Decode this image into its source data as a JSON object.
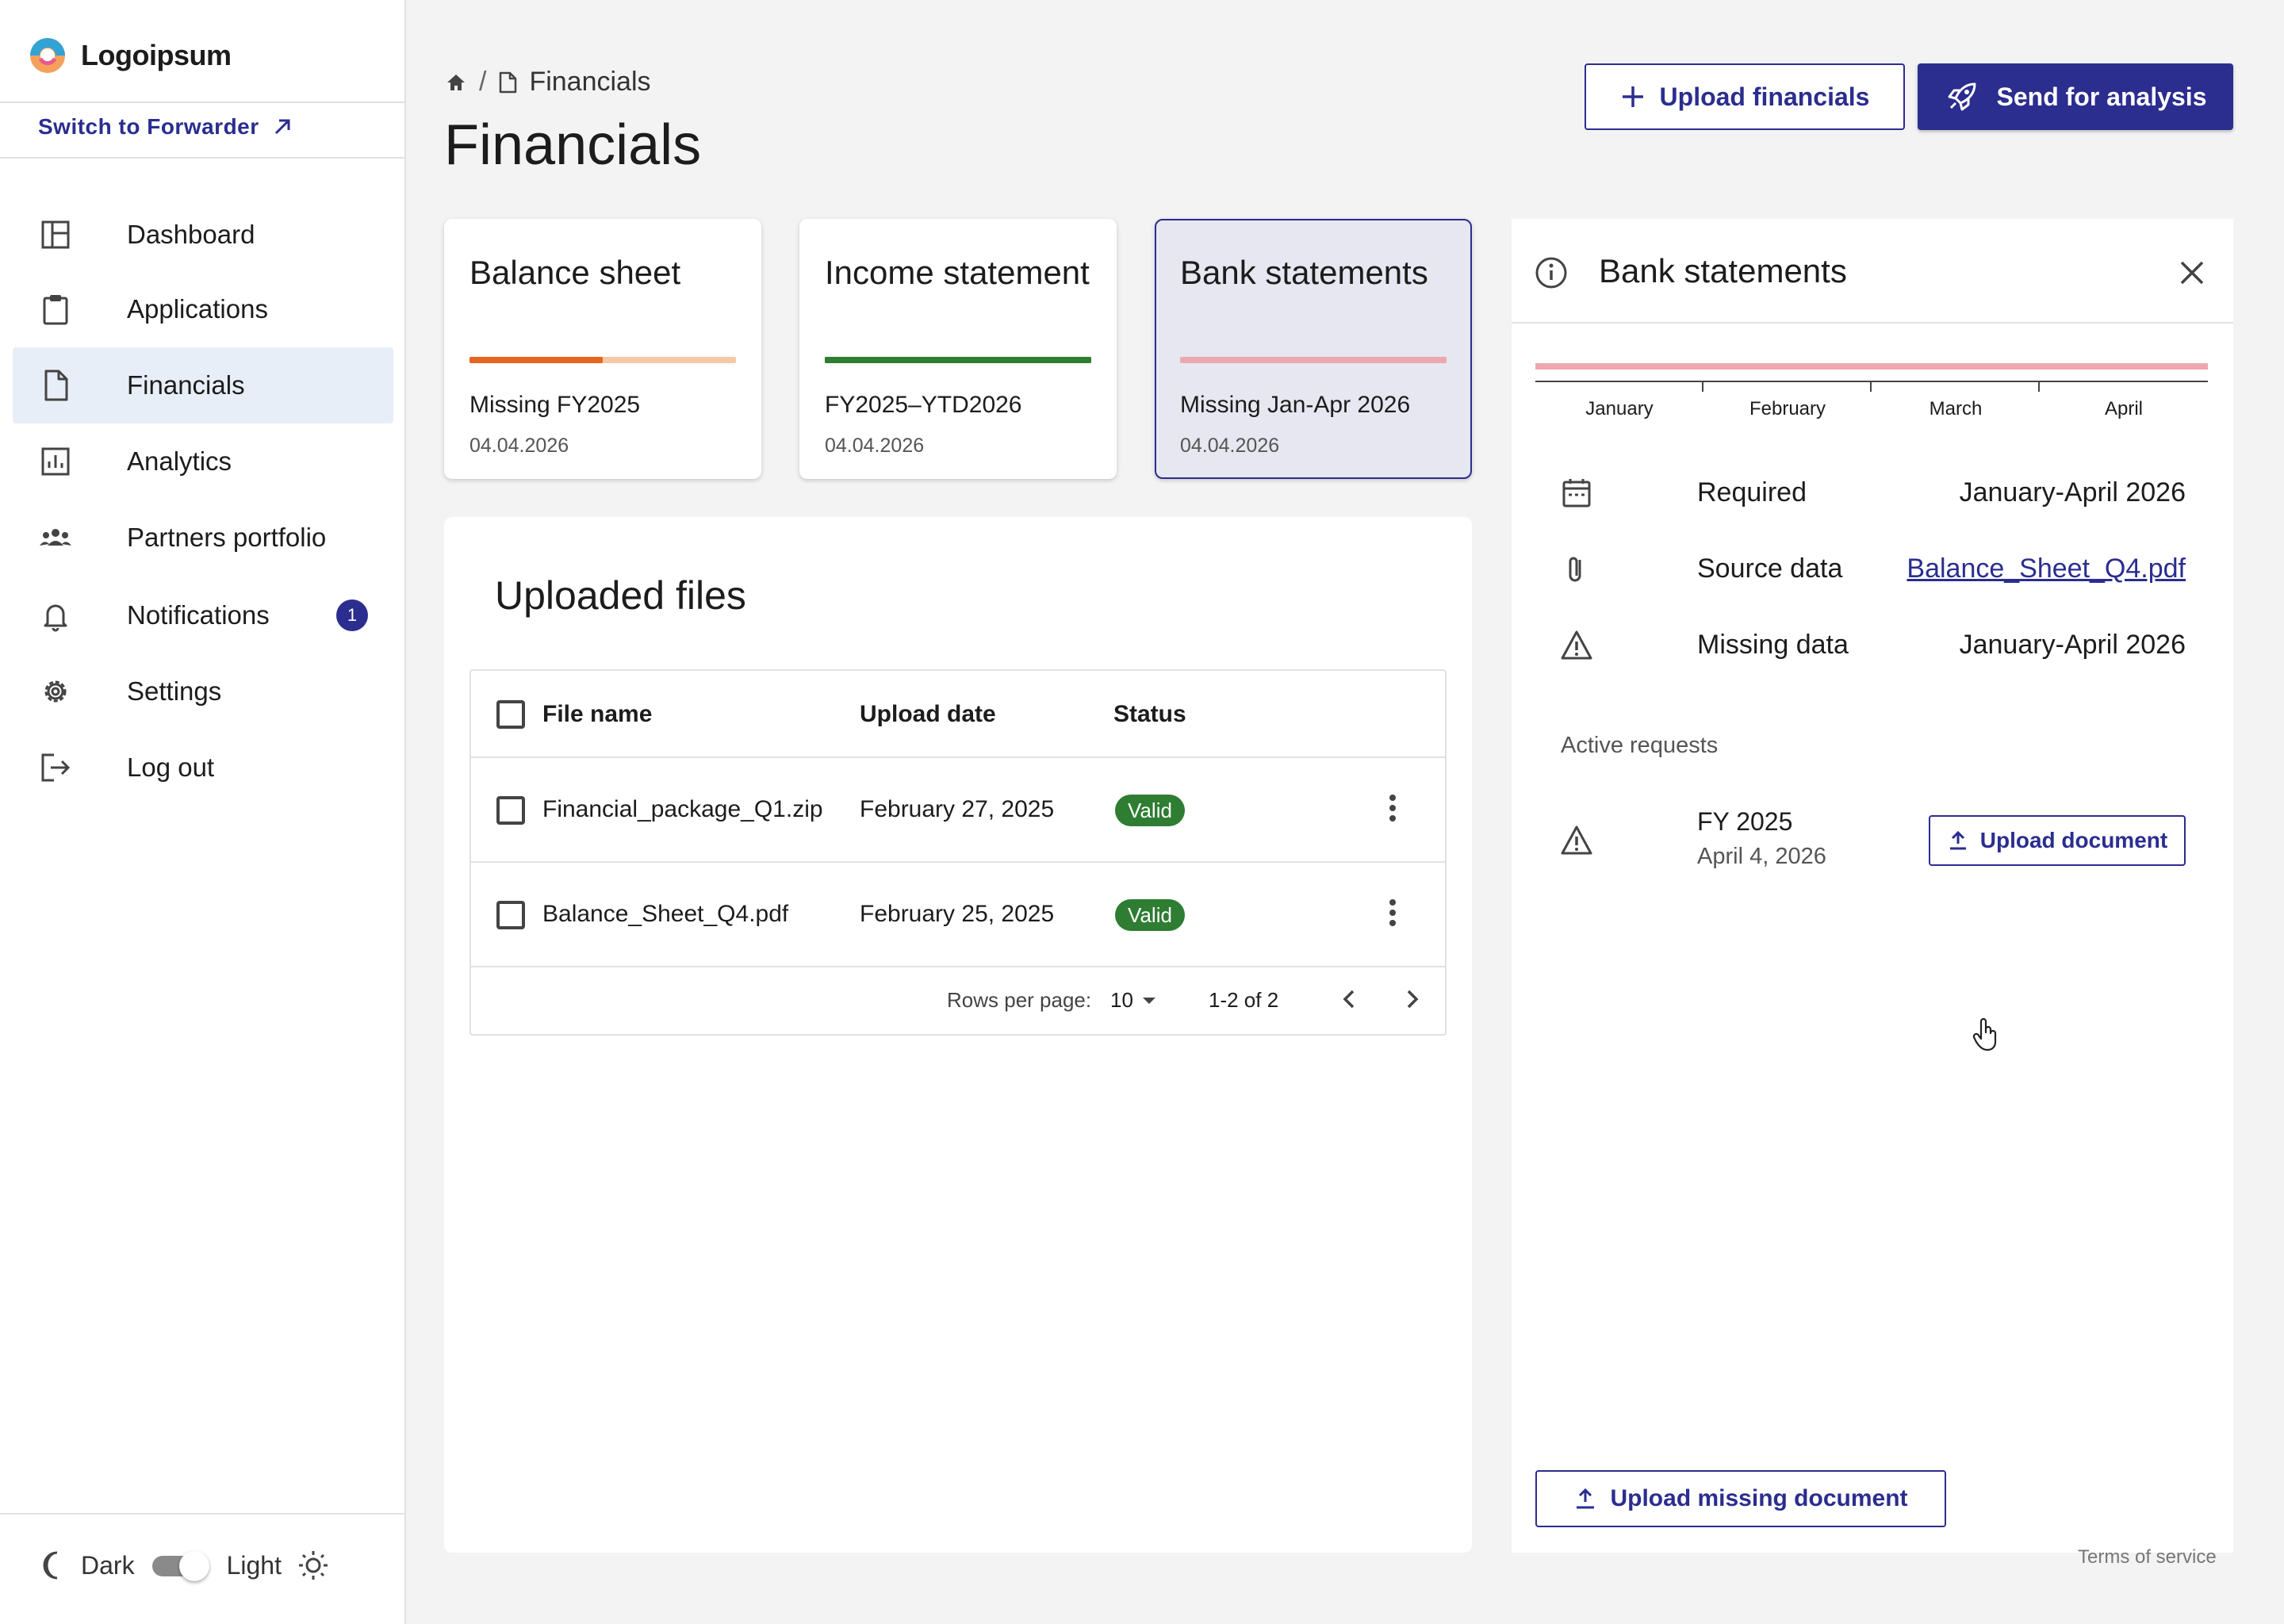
{
  "brand": {
    "name": "Logoipsum"
  },
  "sidebar": {
    "switch_link": "Switch to Forwarder",
    "items": [
      {
        "label": "Dashboard",
        "icon": "dashboard-icon"
      },
      {
        "label": "Applications",
        "icon": "clipboard-icon"
      },
      {
        "label": "Financials",
        "icon": "document-icon",
        "active": true
      },
      {
        "label": "Analytics",
        "icon": "bar-chart-icon"
      },
      {
        "label": "Partners portfolio",
        "icon": "people-icon"
      },
      {
        "label": "Notifications",
        "icon": "bell-icon",
        "badge": "1"
      },
      {
        "label": "Settings",
        "icon": "gear-icon"
      },
      {
        "label": "Log out",
        "icon": "logout-icon"
      }
    ],
    "theme": {
      "dark_label": "Dark",
      "light_label": "Light",
      "selected": "Light"
    }
  },
  "header": {
    "breadcrumb": {
      "current": "Financials"
    },
    "title": "Financials",
    "upload_button": "Upload financials",
    "send_button": "Send for analysis"
  },
  "cards": [
    {
      "title": "Balance sheet",
      "desc": "Missing FY2025",
      "date": "04.04.2026",
      "progress": 0.5,
      "bar_color": "#e8651c",
      "bar_track": "#f5c8a6"
    },
    {
      "title": "Income statement",
      "desc": "FY2025–YTD2026",
      "date": "04.04.2026",
      "progress": 1.0,
      "bar_color": "#2e7d32",
      "bar_track": "#2e7d32"
    },
    {
      "title": "Bank statements",
      "desc": "Missing Jan-Apr 2026",
      "date": "04.04.2026",
      "progress": 0.0,
      "bar_color": "#eca8ae",
      "bar_track": "#eca8ae",
      "selected": true
    }
  ],
  "files": {
    "title": "Uploaded files",
    "columns": {
      "name": "File name",
      "date": "Upload date",
      "status": "Status"
    },
    "rows": [
      {
        "name": "Financial_package_Q1.zip",
        "date": "February 27, 2025",
        "status": "Valid"
      },
      {
        "name": "Balance_Sheet_Q4.pdf",
        "date": "February 25, 2025",
        "status": "Valid"
      }
    ],
    "pagination": {
      "rows_label": "Rows per page:",
      "rows_value": "10",
      "range": "1-2 of 2"
    }
  },
  "detail": {
    "title": "Bank statements",
    "months": [
      "January",
      "February",
      "March",
      "April"
    ],
    "timeline_color": "#eca8ae",
    "info": [
      {
        "label": "Required",
        "value": "January-April 2026",
        "icon": "calendar-icon"
      },
      {
        "label": "Source data",
        "value": "Balance_Sheet_Q4.pdf",
        "icon": "paperclip-icon",
        "link": true
      },
      {
        "label": "Missing data",
        "value": "January-April 2026",
        "icon": "warning-icon"
      }
    ],
    "active_requests_label": "Active requests",
    "requests": [
      {
        "title": "FY 2025",
        "date": "April 4, 2026",
        "button": "Upload document"
      }
    ],
    "upload_missing_button": "Upload missing document"
  },
  "footer": {
    "terms": "Terms of service"
  },
  "colors": {
    "accent": "#2b2d8f",
    "valid": "#2e7d32"
  }
}
